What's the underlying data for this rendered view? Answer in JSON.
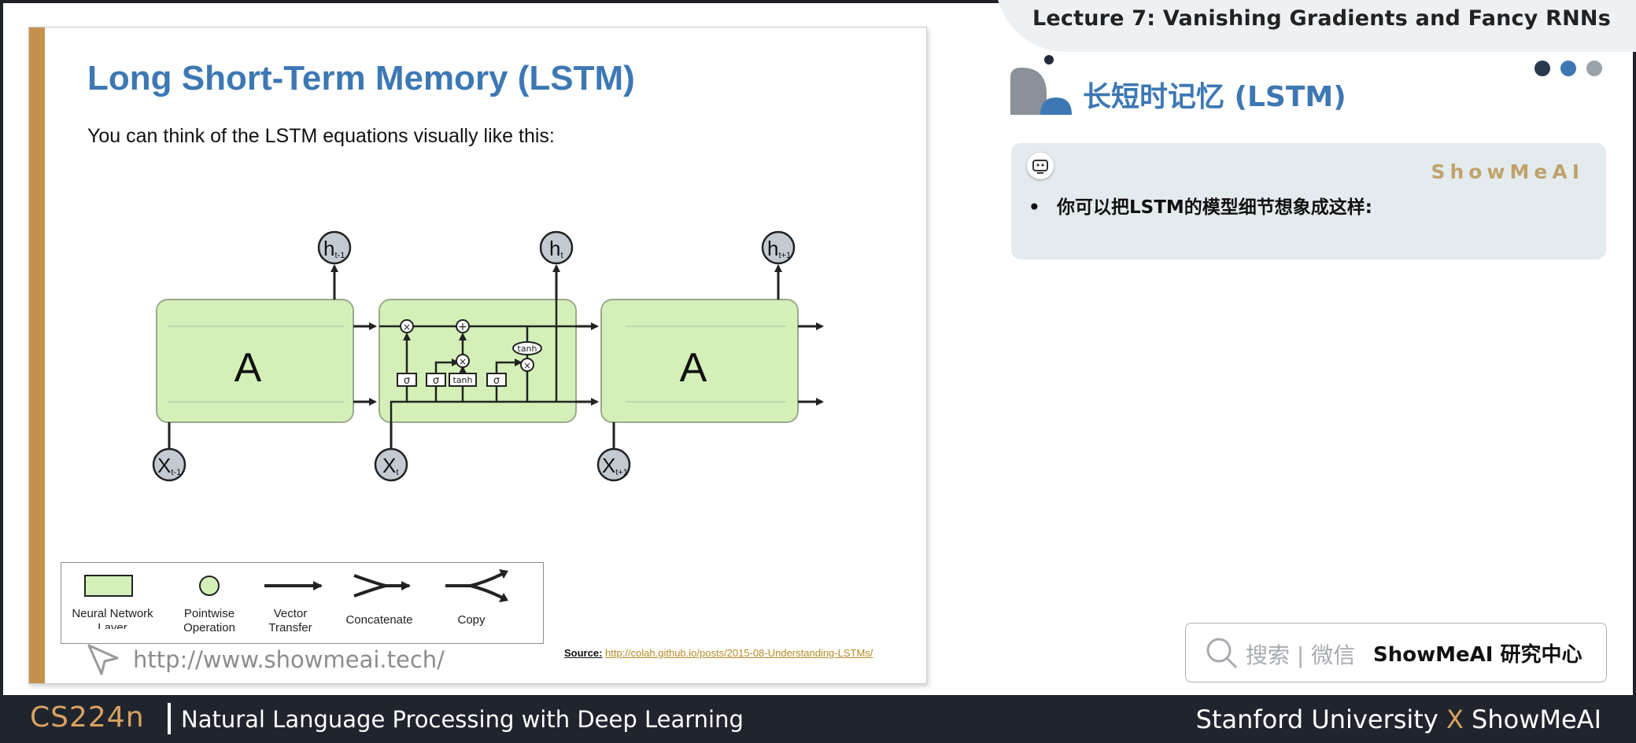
{
  "slide": {
    "title": "Long Short-Term Memory (LSTM)",
    "subtitle": "You can think of the LSTM equations visually like this:",
    "diagram": {
      "cell_label": "A",
      "nodes": {
        "h_prev": "h",
        "h_prev_sub": "t-1",
        "h_cur": "h",
        "h_cur_sub": "t",
        "h_next": "h",
        "h_next_sub": "t+1",
        "x_prev": "X",
        "x_prev_sub": "t-1",
        "x_cur": "X",
        "x_cur_sub": "t",
        "x_next": "X",
        "x_next_sub": "t+1"
      },
      "ops": {
        "multiply": "×",
        "add": "+",
        "tanh": "tanh"
      },
      "gates": [
        "σ",
        "σ",
        "tanh",
        "σ"
      ]
    },
    "legend": {
      "items": [
        {
          "label_line1": "Neural Network",
          "label_line2": "Layer"
        },
        {
          "label_line1": "Pointwise",
          "label_line2": "Operation"
        },
        {
          "label_line1": "Vector",
          "label_line2": "Transfer"
        },
        {
          "label_line1": "Concatenate",
          "label_line2": ""
        },
        {
          "label_line1": "Copy",
          "label_line2": ""
        }
      ]
    },
    "url": "http://www.showmeai.tech/",
    "source_label": "Source:",
    "source_link": "http://colah.github.io/posts/2015-08-Understanding-LSTMs/"
  },
  "header": {
    "lecture_title": "Lecture 7:  Vanishing Gradients and Fancy RNNs",
    "dots": [
      "#2b3a4f",
      "#3d78b4",
      "#9aa3aa"
    ]
  },
  "panel": {
    "cn_title": "长短时记忆 (LSTM)",
    "brand": "ShowMeAI",
    "bullet": "•",
    "note": "你可以把LSTM的模型细节想象成这样:"
  },
  "search": {
    "hint": "搜索 | 微信",
    "brand": "ShowMeAI 研究中心"
  },
  "footer": {
    "course_code": "CS224n",
    "course_name": "Natural Language Processing with Deep Learning",
    "affil_left": "Stanford University",
    "affil_x": "X",
    "affil_right": "ShowMeAI"
  },
  "colors": {
    "accent_blue": "#3d78b4",
    "gold": "#c6914f",
    "cell_green": "#d4f0b8",
    "footer_bg": "#20252d"
  }
}
